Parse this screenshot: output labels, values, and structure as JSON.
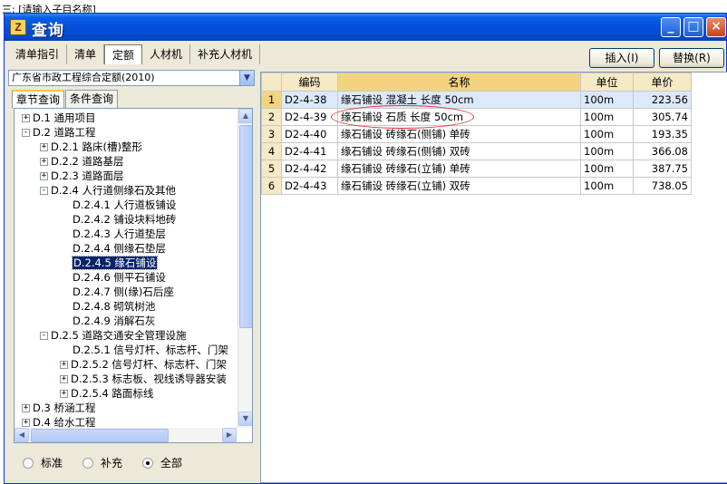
{
  "background": {
    "top_text": "三: [请输入子目名称]"
  },
  "window": {
    "title": "查询",
    "title_icon": "app-icon",
    "buttons": {
      "minimize": "_",
      "maximize": "□",
      "close": "×"
    }
  },
  "tabs": [
    {
      "label": "清单指引"
    },
    {
      "label": "清单"
    },
    {
      "label": "定额",
      "active": true
    },
    {
      "label": "人材机"
    },
    {
      "label": "补充人材机"
    }
  ],
  "actions": {
    "insert": "插入(I)",
    "replace": "替换(R)"
  },
  "quota_library": {
    "selected": "广东省市政工程综合定额(2010)"
  },
  "subtabs": [
    {
      "label": "章节查询",
      "active": true
    },
    {
      "label": "条件查询"
    }
  ],
  "tree": [
    {
      "exp": "+",
      "label": "D.1 通用项目"
    },
    {
      "exp": "-",
      "label": "D.2 道路工程"
    },
    {
      "exp": "+",
      "label": "D.2.1 路床(槽)整形"
    },
    {
      "exp": "+",
      "label": "D.2.2 道路基层"
    },
    {
      "exp": "+",
      "label": "D.2.3 道路面层"
    },
    {
      "exp": "-",
      "label": "D.2.4 人行道侧缘石及其他"
    },
    {
      "exp": "",
      "label": "D.2.4.1 人行道板铺设"
    },
    {
      "exp": "",
      "label": "D.2.4.2 铺设块料地砖"
    },
    {
      "exp": "",
      "label": "D.2.4.3 人行道垫层"
    },
    {
      "exp": "",
      "label": "D.2.4.4 侧缘石垫层"
    },
    {
      "exp": "",
      "label": "D.2.4.5 缘石铺设",
      "selected": true
    },
    {
      "exp": "",
      "label": "D.2.4.6 侧平石铺设"
    },
    {
      "exp": "",
      "label": "D.2.4.7 侧(缘)石后座"
    },
    {
      "exp": "",
      "label": "D.2.4.8 砌筑树池"
    },
    {
      "exp": "",
      "label": "D.2.4.9 消解石灰"
    },
    {
      "exp": "-",
      "label": "D.2.5 道路交通安全管理设施"
    },
    {
      "exp": "",
      "label": "D.2.5.1 信号灯杆、标志杆、门架"
    },
    {
      "exp": "+",
      "label": "D.2.5.2 信号灯杆、标志杆、门架"
    },
    {
      "exp": "+",
      "label": "D.2.5.3 标志板、视线诱导器安装"
    },
    {
      "exp": "+",
      "label": "D.2.5.4 路面标线"
    },
    {
      "exp": "+",
      "label": "D.3 桥涵工程"
    },
    {
      "exp": "+",
      "label": "D.4 给水工程"
    }
  ],
  "filter": {
    "options": [
      {
        "label": "标准",
        "checked": false
      },
      {
        "label": "补充",
        "checked": false
      },
      {
        "label": "全部",
        "checked": true
      }
    ]
  },
  "grid": {
    "headers": [
      "",
      "编码",
      "名称",
      "单位",
      "单价"
    ],
    "rows": [
      {
        "n": "1",
        "code": "D2-4-38",
        "name": "缘石铺设 混凝土 长度 50cm",
        "unit": "100m",
        "price": "223.56"
      },
      {
        "n": "2",
        "code": "D2-4-39",
        "name": "缘石铺设 石质 长度 50cm",
        "unit": "100m",
        "price": "305.74"
      },
      {
        "n": "3",
        "code": "D2-4-40",
        "name": "缘石铺设 砖缘石(侧铺) 单砖",
        "unit": "100m",
        "price": "193.35"
      },
      {
        "n": "4",
        "code": "D2-4-41",
        "name": "缘石铺设 砖缘石(侧铺) 双砖",
        "unit": "100m",
        "price": "366.08"
      },
      {
        "n": "5",
        "code": "D2-4-42",
        "name": "缘石铺设 砖缘石(立铺) 单砖",
        "unit": "100m",
        "price": "387.75"
      },
      {
        "n": "6",
        "code": "D2-4-43",
        "name": "缘石铺设 砖缘石(立铺) 双砖",
        "unit": "100m",
        "price": "738.05"
      }
    ]
  }
}
